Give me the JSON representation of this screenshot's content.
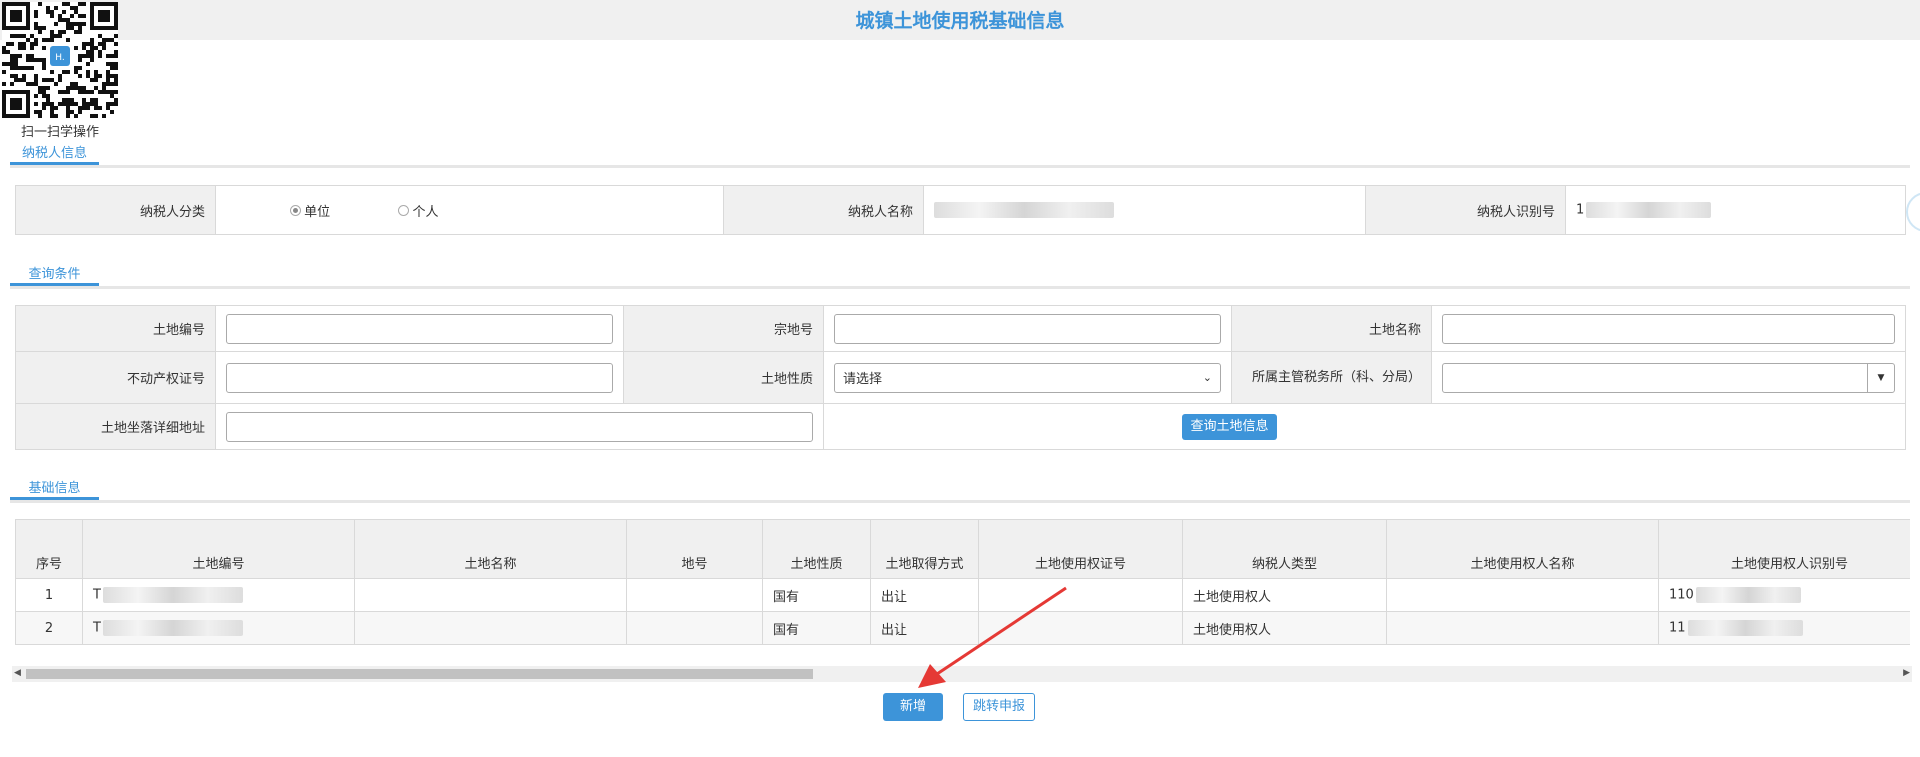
{
  "page": {
    "title": "城镇土地使用税基础信息",
    "qr_caption": "扫一扫学操作",
    "qr_logo_text": "H."
  },
  "sections": {
    "taxpayer": "纳税人信息",
    "query": "查询条件",
    "basic": "基础信息"
  },
  "taxpayer": {
    "category_label": "纳税人分类",
    "category_options": [
      "单位",
      "个人"
    ],
    "category_selected": "单位",
    "name_label": "纳税人名称",
    "id_label": "纳税人识别号",
    "id_value_prefix": "1"
  },
  "query": {
    "land_no_label": "土地编号",
    "parcel_no_label": "宗地号",
    "land_name_label": "土地名称",
    "property_cert_label": "不动产权证号",
    "land_nature_label": "土地性质",
    "land_nature_placeholder": "请选择",
    "tax_office_label": "所属主管税务所（科、分局）",
    "address_label": "土地坐落详细地址",
    "search_button": "查询土地信息"
  },
  "grid": {
    "columns": [
      "序号",
      "土地编号",
      "土地名称",
      "地号",
      "土地性质",
      "土地取得方式",
      "土地使用权证号",
      "纳税人类型",
      "土地使用权人名称",
      "土地使用权人识别号"
    ],
    "rows": [
      {
        "seq": "1",
        "land_no": "T",
        "land_name": "",
        "parcel": "",
        "nature": "国有",
        "acquire": "出让",
        "cert": "",
        "taxpayer_type": "土地使用权人",
        "owner_name": "",
        "owner_id": "110"
      },
      {
        "seq": "2",
        "land_no": "T",
        "land_name": "",
        "parcel": "",
        "nature": "国有",
        "acquire": "出让",
        "cert": "",
        "taxpayer_type": "土地使用权人",
        "owner_name": "",
        "owner_id": "11"
      }
    ]
  },
  "actions": {
    "add": "新增",
    "jump": "跳转申报"
  },
  "colors": {
    "accent": "#3d94d9",
    "arrow": "#e53935",
    "label_bg": "#f0f0f0"
  }
}
